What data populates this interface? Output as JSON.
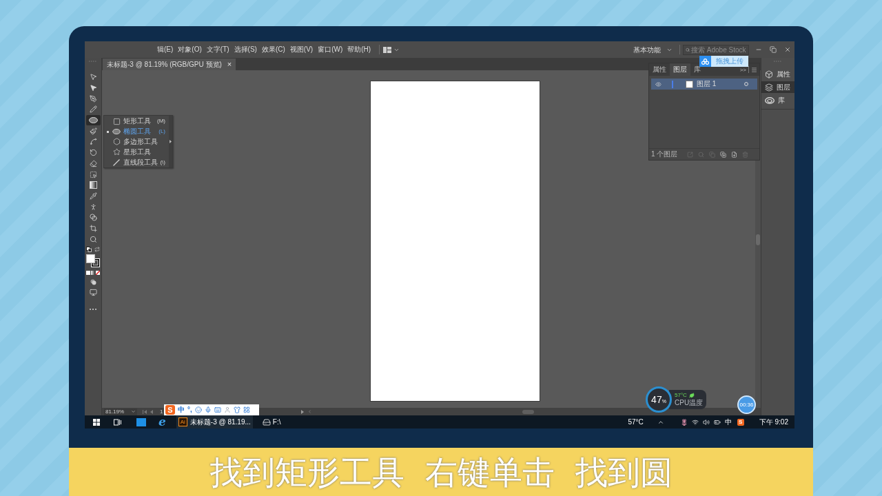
{
  "menu_bar": {
    "items": [
      "辑(E)",
      "对象(O)",
      "文字(T)",
      "选择(S)",
      "效果(C)",
      "视图(V)",
      "窗口(W)",
      "帮助(H)"
    ],
    "workspace": "基本功能",
    "search": {
      "placeholder": "搜索 Adobe Stock"
    }
  },
  "document_tab": {
    "title": "未标题-3 @ 81.19% (RGB/GPU 预览)",
    "close": "×"
  },
  "upload_button": {
    "label": "拖拽上传"
  },
  "tools": [
    {
      "selected": false
    },
    {
      "selected": false
    },
    {
      "selected": false
    },
    {
      "selected": false
    },
    {
      "selected": true
    },
    {
      "selected": false
    },
    {
      "selected": false
    },
    {
      "selected": false
    },
    {
      "selected": false
    },
    {
      "selected": false
    },
    {
      "selected": false
    },
    {
      "selected": false
    },
    {
      "selected": false
    },
    {
      "selected": false
    },
    {
      "selected": false
    },
    {
      "selected": false
    }
  ],
  "tool_flyout": {
    "items": [
      {
        "label": "矩形工具",
        "shortcut": "(M)",
        "selected": false
      },
      {
        "label": "椭圆工具",
        "shortcut": "(L)",
        "selected": true
      },
      {
        "label": "多边形工具",
        "selected": false
      },
      {
        "label": "星形工具",
        "selected": false
      },
      {
        "label": "直线段工具",
        "shortcut": "(\\)",
        "selected": false
      }
    ]
  },
  "layers_panel": {
    "tabs": [
      {
        "label": "属性",
        "selected": false
      },
      {
        "label": "图层",
        "selected": true
      },
      {
        "label": "库",
        "selected": false
      }
    ],
    "expand": ">>",
    "layers": [
      {
        "name": "图层 1",
        "visible": true,
        "selected": true
      }
    ],
    "footer": "1 个图层"
  },
  "dock": [
    {
      "label": "属性",
      "selected": false
    },
    {
      "label": "图层",
      "selected": true
    },
    {
      "label": "库",
      "selected": false
    }
  ],
  "status_bar": {
    "zoom": "81.19%",
    "page": "1"
  },
  "ime_toolbar": {
    "logo": "S",
    "mode": "中",
    "punctuation": "°,"
  },
  "cpu_monitor": {
    "usage": "47",
    "unit": "%",
    "temperature": "57°C",
    "label": "CPU温度"
  },
  "timer": "00:36",
  "taskbar": {
    "ai_icon": "Ai",
    "app_title": "未标题-3 @ 81.19...",
    "drive": "F:\\",
    "temperature": "57°C",
    "ime": "中",
    "ime_logo": "S",
    "time": "下午 9:02",
    "browser_logo": "e"
  },
  "caption": [
    "找到矩形工具",
    "右键单击",
    "找到圆"
  ]
}
